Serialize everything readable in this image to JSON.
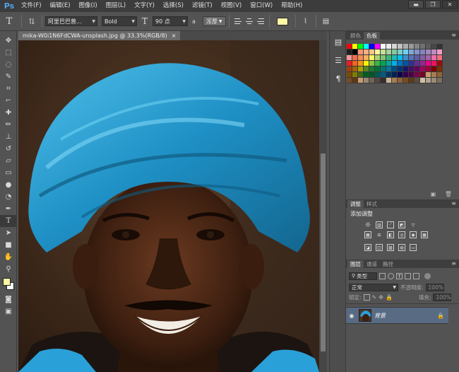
{
  "app": {
    "logo": "Ps"
  },
  "menu": [
    "文件(F)",
    "编辑(E)",
    "图像(I)",
    "图层(L)",
    "文字(Y)",
    "选择(S)",
    "滤镜(T)",
    "视图(V)",
    "窗口(W)",
    "帮助(H)"
  ],
  "window_controls": {
    "minimize": "▬",
    "maximize": "❐",
    "close": "✕"
  },
  "options": {
    "font_family": "阿里巴巴普...",
    "font_style": "Bold",
    "font_size": "90 点",
    "aa_label": "a",
    "antialias": "浑厚",
    "text_color": "#fef7a4"
  },
  "document": {
    "tab_title": "mika-W0i1N6FdCWA-unsplash.jpg @ 33.3%(RGB/8)",
    "tab_close": "×"
  },
  "panels": {
    "color_tab": "颜色",
    "swatches_tab": "色板",
    "adjustments_tab": "调整",
    "styles_tab": "样式",
    "adjust_title": "添加调整",
    "layers_tab": "图层",
    "channels_tab": "通道",
    "paths_tab": "路径",
    "layer_kind": "类型",
    "blend_mode": "正常",
    "opacity_label": "不透明度:",
    "opacity_value": "100%",
    "lock_label": "锁定:",
    "fill_label": "填充:",
    "fill_value": "100%",
    "layer_name": "背景"
  },
  "swatch_colors": [
    [
      "#ff0000",
      "#ffff00",
      "#00ff00",
      "#00ffff",
      "#0000ff",
      "#ff00ff",
      "#ffffff",
      "#ebebeb",
      "#d6d6d6",
      "#c2c2c2",
      "#adadad",
      "#999999",
      "#858585",
      "#707070",
      "#5c5c5c",
      "#474747",
      "#333333"
    ],
    [
      "#1f1f1f",
      "#000000",
      "#f7977a",
      "#f9ad81",
      "#fdc68a",
      "#fff79a",
      "#c4df9b",
      "#a2d39c",
      "#82ca9d",
      "#7bcdc8",
      "#6ecff6",
      "#7ea7d8",
      "#8493ca",
      "#8882be",
      "#a187be",
      "#bc8dbf",
      "#f49ac2"
    ],
    [
      "#f6989d",
      "#f26c4f",
      "#f68e55",
      "#fbaf5c",
      "#fff467",
      "#acd372",
      "#7cc576",
      "#3bb878",
      "#1abbb4",
      "#00bff3",
      "#438cca",
      "#5574b9",
      "#605ca8",
      "#855fa8",
      "#a763a8",
      "#f06ea9",
      "#f26d7d"
    ],
    [
      "#ed1c24",
      "#f26522",
      "#f7941d",
      "#fff200",
      "#8dc73f",
      "#39b54a",
      "#00a651",
      "#00a99d",
      "#00aeef",
      "#0072bc",
      "#0054a6",
      "#2e3192",
      "#662d91",
      "#92278f",
      "#ec008c",
      "#ed145b",
      "#9e0b0f"
    ],
    [
      "#a0410d",
      "#a36209",
      "#aba000",
      "#598527",
      "#1a7b30",
      "#007236",
      "#00746b",
      "#0076a3",
      "#004b80",
      "#003471",
      "#1b1464",
      "#440e62",
      "#630460",
      "#9e005d",
      "#9e0039",
      "#790000",
      "#7b2e00"
    ],
    [
      "#7d4900",
      "#827b00",
      "#406618",
      "#005e20",
      "#005826",
      "#005952",
      "#005b7f",
      "#003663",
      "#002157",
      "#0d004c",
      "#32004b",
      "#4b0049",
      "#7b0046",
      "#7a0026",
      "#c69c6d",
      "#a67c52",
      "#8c6239"
    ],
    [
      "#754c24",
      "#603913",
      "#c69c6d",
      "#998675",
      "#736357",
      "#534741",
      "#362f2d",
      "#c7b299",
      "#a67c52",
      "#8c6239",
      "#754c24",
      "#603913",
      "#594a42",
      "#d0c0a8",
      "#b2a38f",
      "#9a8c78",
      "#7d6f5e"
    ]
  ]
}
